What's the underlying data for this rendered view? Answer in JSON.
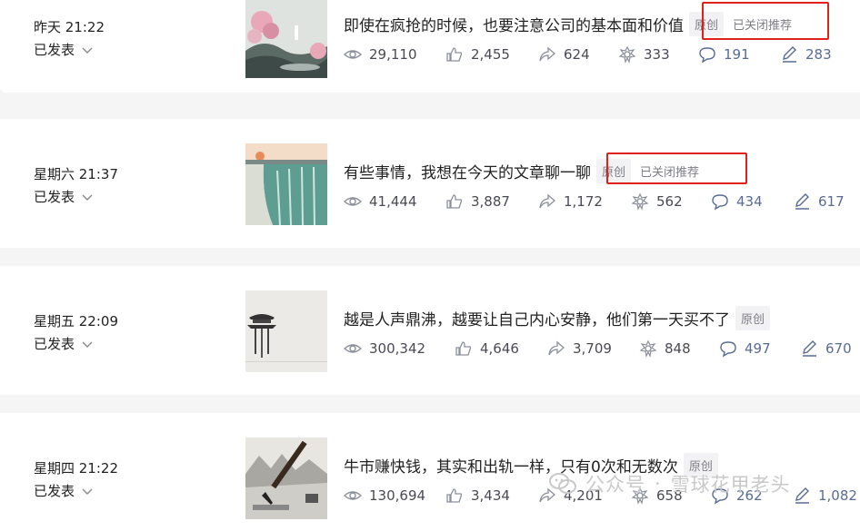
{
  "articles": [
    {
      "date": "昨天 21:22",
      "status": "已发表",
      "title": "即使在疯抢的时候，也要注意公司的基本面和价值",
      "badge": "原创",
      "recommend": "已关闭推荐",
      "stats": {
        "views": "29,110",
        "likes": "2,455",
        "shares": "624",
        "wow": "333",
        "comments": "191",
        "edits": "283"
      }
    },
    {
      "date": "星期六 21:37",
      "status": "已发表",
      "title": "有些事情，我想在今天的文章聊一聊",
      "badge": "原创",
      "recommend": "已关闭推荐",
      "stats": {
        "views": "41,444",
        "likes": "3,887",
        "shares": "1,172",
        "wow": "562",
        "comments": "434",
        "edits": "617"
      }
    },
    {
      "date": "星期五 22:09",
      "status": "已发表",
      "title": "越是人声鼎沸，越要让自己内心安静，他们第一天买不了",
      "badge": "原创",
      "stats": {
        "views": "300,342",
        "likes": "4,646",
        "shares": "3,709",
        "wow": "848",
        "comments": "497",
        "edits": "670"
      }
    },
    {
      "date": "星期四 21:22",
      "status": "已发表",
      "title": "牛市赚快钱，其实和出轨一样，只有0次和无数次",
      "badge": "原创",
      "stats": {
        "views": "130,694",
        "likes": "3,434",
        "shares": "4,201",
        "wow": "658",
        "comments": "262",
        "edits": "1,082"
      }
    }
  ],
  "watermark": {
    "channel": "公众号",
    "account": "雪球花甲老头"
  },
  "colors": {
    "highlight_box": "#e0201a",
    "badge_bg": "#f2f2f4",
    "icon": "#8a8f99"
  }
}
